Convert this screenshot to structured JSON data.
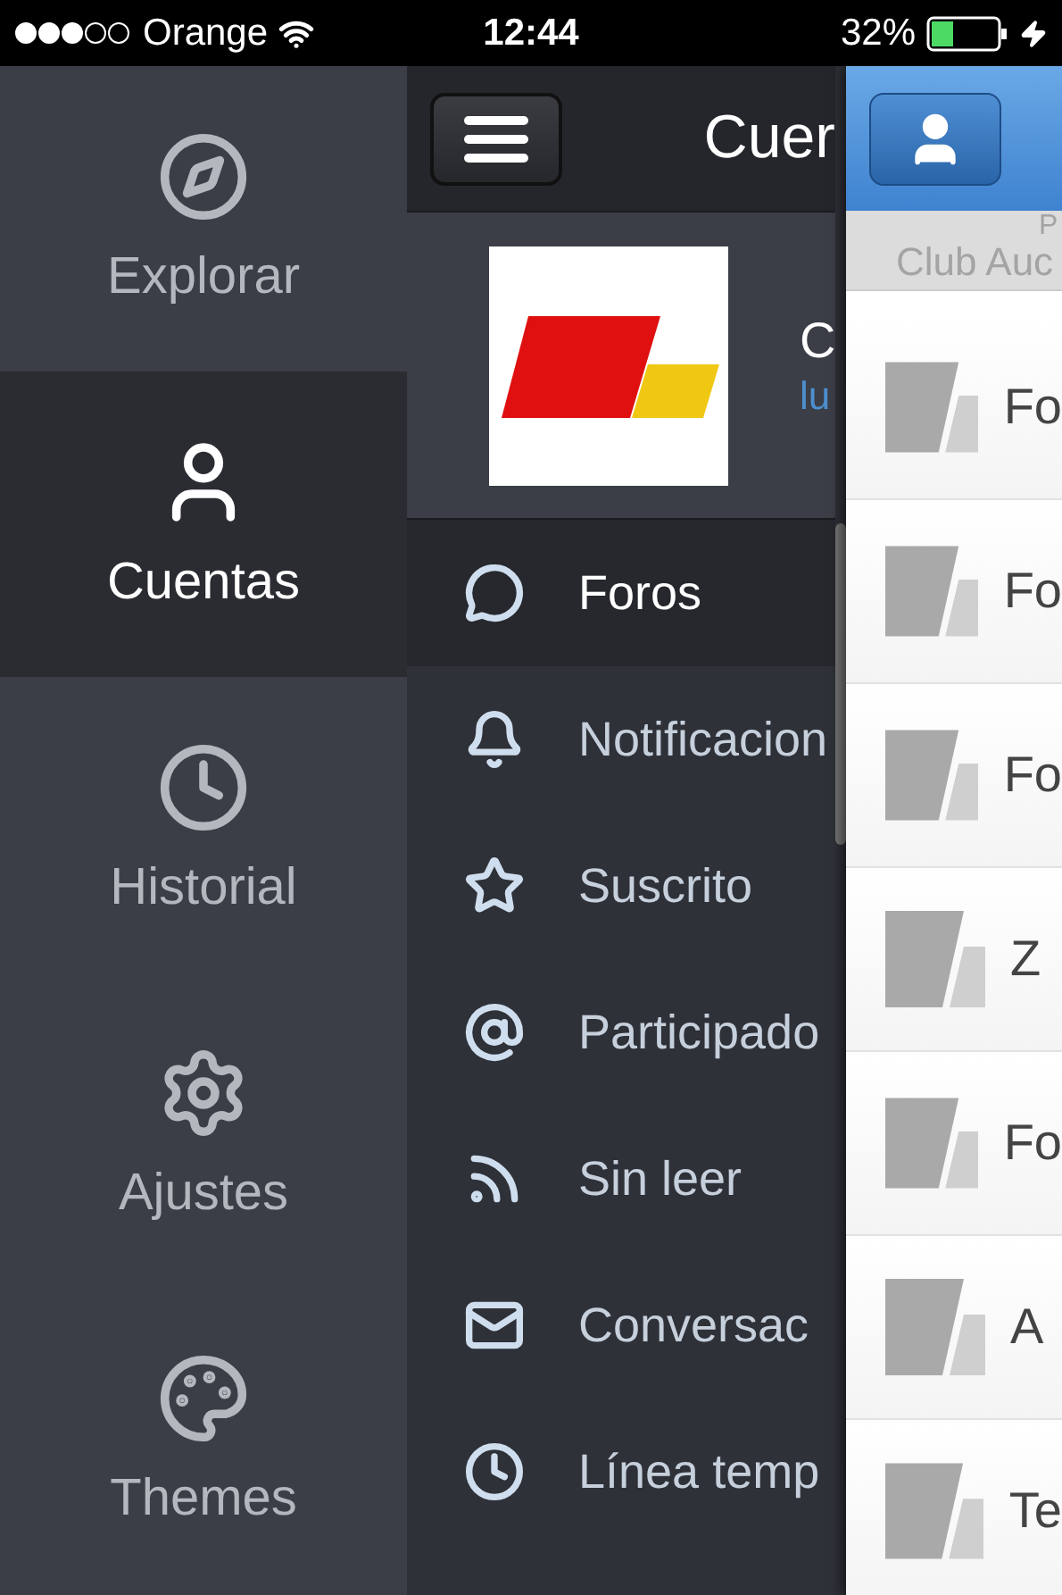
{
  "status_bar": {
    "carrier": "Orange",
    "time": "12:44",
    "battery": "32%"
  },
  "sidebar": {
    "items": [
      {
        "label": "Explorar",
        "selected": false
      },
      {
        "label": "Cuentas",
        "selected": true
      },
      {
        "label": "Historial",
        "selected": false
      },
      {
        "label": "Ajustes",
        "selected": false
      },
      {
        "label": "Themes",
        "selected": false
      }
    ]
  },
  "account_panel": {
    "title": "Cuer",
    "profile": {
      "name": "C",
      "subtitle": "lu"
    },
    "menu": [
      {
        "label": "Foros",
        "selected": true
      },
      {
        "label": "Notificacion",
        "selected": false
      },
      {
        "label": "Suscrito",
        "selected": false
      },
      {
        "label": "Participado",
        "selected": false
      },
      {
        "label": "Sin leer",
        "selected": false
      },
      {
        "label": "Conversac",
        "selected": false
      },
      {
        "label": "Línea temp",
        "selected": false
      }
    ]
  },
  "forum_panel": {
    "banner": {
      "line_1": "P",
      "line_2": "Club Auc"
    },
    "rows": [
      {
        "label": "Fo"
      },
      {
        "label": "Fo"
      },
      {
        "label": "Fo"
      },
      {
        "label": "Z"
      },
      {
        "label": "Fo"
      },
      {
        "label": "A"
      },
      {
        "label": "Te"
      }
    ]
  }
}
